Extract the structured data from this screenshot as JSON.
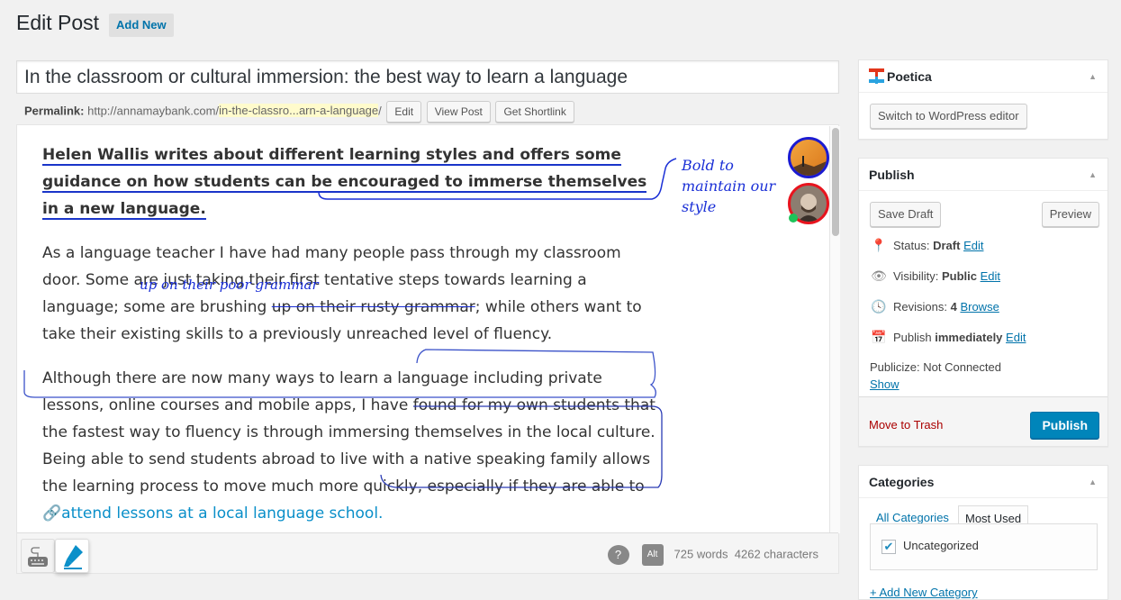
{
  "header": {
    "title": "Edit Post",
    "add_new": "Add New"
  },
  "post": {
    "title": "In the classroom or cultural immersion: the best way to learn a language",
    "permalink_label": "Permalink:",
    "permalink_base": "http://annamaybank.com/",
    "permalink_slug": "in-the-classro...arn-a-language",
    "permalink_trail": "/",
    "permalink_buttons": [
      "Edit",
      "View Post",
      "Get Shortlink"
    ]
  },
  "content": {
    "lead_part1": "Helen Wallis writes about different learning styles and offers some guidance on how students can be encouraged to ",
    "lead_part2": "immerse themselves in a new language.",
    "p1_a": "As a language teacher I have had many people pass through my classroom door. Some are just taking their first tentative steps towards learning a language; some are brushing ",
    "p1_strike": "up on their rusty grammar",
    "p1_b": "; while others want to take their existing skills to a previously unreached level of fluency.",
    "p2_a": "Although there are now many ways to learn a language including private lessons, online courses and mobile apps, I have found for my own students that the fastest way to fluency is through immersing themselves in the local culture. Being able to send students abroad to live with a native speaking family allows the learning process to move much more quickly, especially if they are able to ",
    "p2_link": "attend lessons at a local language school."
  },
  "annotations": {
    "margin_note": "Bold to maintain our style",
    "inline_suggestion": "up on their poor grammar"
  },
  "collaborators": [
    {
      "name": "collaborator-1",
      "ring_color": "#1b1bd1"
    },
    {
      "name": "collaborator-2",
      "ring_color": "#e8141e",
      "online": true,
      "status_color": "#1ec45a"
    }
  ],
  "editor_footer": {
    "help_icon": "?",
    "alt_label": "Alt",
    "word_count": "725 words",
    "char_count": "4262 characters"
  },
  "sidebar": {
    "poetica": {
      "title": "Poetica",
      "switch_button": "Switch to WordPress editor"
    },
    "publish": {
      "title": "Publish",
      "save_draft": "Save Draft",
      "preview": "Preview",
      "status_label": "Status:",
      "status_value": "Draft",
      "status_edit": "Edit",
      "visibility_label": "Visibility:",
      "visibility_value": "Public",
      "visibility_edit": "Edit",
      "revisions_label": "Revisions:",
      "revisions_value": "4",
      "revisions_browse": "Browse",
      "schedule_label": "Publish",
      "schedule_value": "immediately",
      "schedule_edit": "Edit",
      "publicize": "Publicize: Not Connected",
      "publicize_show": "Show",
      "trash": "Move to Trash",
      "publish_button": "Publish"
    },
    "categories": {
      "title": "Categories",
      "tabs": [
        "All Categories",
        "Most Used"
      ],
      "active_tab": "Most Used",
      "items": [
        {
          "label": "Uncategorized",
          "checked": true
        }
      ],
      "add_new": "+ Add New Category"
    }
  }
}
